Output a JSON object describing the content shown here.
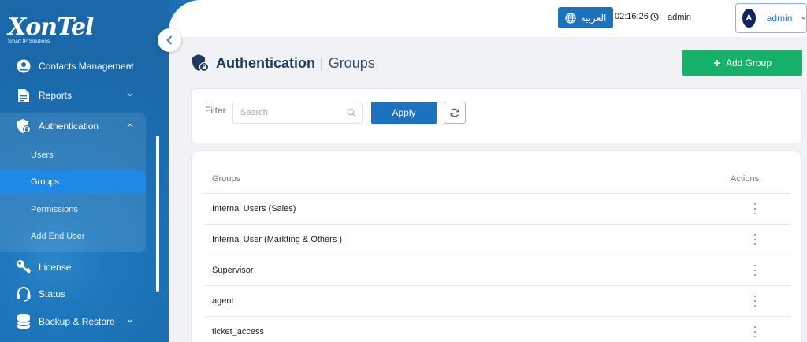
{
  "brand": {
    "logo_text": "XonTel",
    "tagline": "Smart IP Solutions"
  },
  "sidebar": {
    "items": [
      {
        "label": "Contacts Management",
        "icon": "user-circle-icon",
        "has_chevron": true
      },
      {
        "label": "Reports",
        "icon": "document-icon",
        "has_chevron": true
      },
      {
        "label": "Authentication",
        "icon": "shield-lock-icon",
        "has_chevron": true,
        "expanded": true
      },
      {
        "label": "License",
        "icon": "key-icon",
        "has_chevron": false
      },
      {
        "label": "Status",
        "icon": "headset-icon",
        "has_chevron": false
      },
      {
        "label": "Backup & Restore",
        "icon": "database-icon",
        "has_chevron": true
      }
    ],
    "auth_subitems": [
      {
        "label": "Users",
        "active": false
      },
      {
        "label": "Groups",
        "active": true
      },
      {
        "label": "Permissions",
        "active": false
      },
      {
        "label": "Add End User",
        "active": false
      }
    ]
  },
  "topbar": {
    "language_label": "العربية",
    "time": "02:16:26",
    "username": "admin",
    "avatar_initial": "A",
    "user_menu_name": "admin"
  },
  "page": {
    "title": "Authentication",
    "separator": "|",
    "subtitle": "Groups",
    "add_button_label": "Add Group"
  },
  "filter": {
    "label": "Filter",
    "search_placeholder": "Search",
    "apply_label": "Apply"
  },
  "table": {
    "columns": [
      "Groups",
      "Actions"
    ],
    "rows": [
      {
        "name": "Internal Users (Sales)"
      },
      {
        "name": "Internal User (Markting & Others )"
      },
      {
        "name": "Supervisor"
      },
      {
        "name": "agent"
      },
      {
        "name": "ticket_access"
      }
    ]
  },
  "colors": {
    "sidebar_bg": "#1b6fb2",
    "primary": "#1d72c0",
    "success": "#15b06a",
    "active_item": "#1e8ae6"
  }
}
